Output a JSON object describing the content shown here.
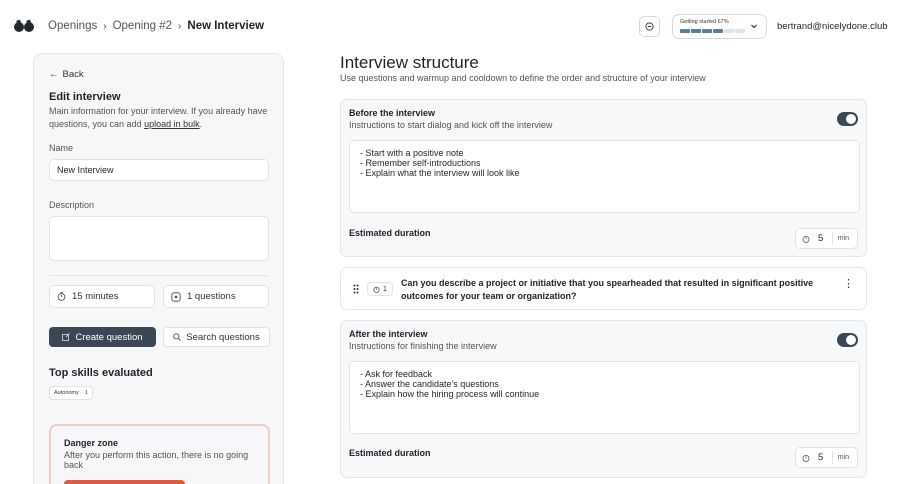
{
  "breadcrumb": {
    "items": [
      "Openings",
      "Opening #2"
    ],
    "current": "New Interview"
  },
  "header": {
    "progress_label": "Getting started 67%",
    "progress_fraction": 0.67,
    "progress_segments_on": 4,
    "progress_segments_total": 6,
    "user_email": "bertrand@nicelydone.club"
  },
  "sidebar": {
    "back_label": "Back",
    "edit_title": "Edit interview",
    "edit_desc_prefix": "Main information for your interview. If you already have questions, you can add ",
    "edit_desc_link": "upload in bulk",
    "edit_desc_suffix": ".",
    "name_label": "Name",
    "name_value": "New Interview",
    "description_label": "Description",
    "description_value": "",
    "duration_text": "15 minutes",
    "questions_text": "1 questions",
    "create_question_label": "Create question",
    "search_questions_label": "Search questions",
    "skills_title": "Top skills evaluated",
    "skills": [
      {
        "name": "Autonomy",
        "count": "1"
      }
    ],
    "danger_title": "Danger zone",
    "danger_desc": "After you perform this action, there is no going back"
  },
  "main": {
    "title": "Interview structure",
    "subtitle": "Use questions and warmup and cooldown to define the order and structure of your interview",
    "before": {
      "title": "Before the interview",
      "subtitle": "Instructions to start dialog and kick off the interview",
      "enabled": true,
      "lines": [
        "- Start with a positive note",
        "- Remember self-introductions",
        "- Explain what the interview will look like"
      ],
      "duration_label": "Estimated duration",
      "duration_value": "5",
      "duration_unit": "min"
    },
    "question": {
      "badge_count": "1",
      "text": "Can you describe a project or initiative that you spearheaded that resulted in significant positive outcomes for your team or organization?"
    },
    "after": {
      "title": "After the interview",
      "subtitle": "Instructions for finishing the interview",
      "enabled": true,
      "lines": [
        "- Ask for feedback",
        "- Answer the candidate's questions",
        "- Explain how the hiring process will continue"
      ],
      "duration_label": "Estimated duration",
      "duration_value": "5",
      "duration_unit": "min"
    }
  },
  "colors": {
    "accent_dark": "#3b4754",
    "progress_on": "#5a7e9b",
    "danger": "#e2573d",
    "danger_border": "#f0cdc0"
  },
  "icons": [
    "logo-icon",
    "chevron-right-icon",
    "bell-icon",
    "chevron-down-icon",
    "arrow-left-icon",
    "timer-icon",
    "question-icon",
    "create-icon",
    "search-icon",
    "drag-handle-icon",
    "kebab-menu-icon",
    "clock-icon"
  ]
}
